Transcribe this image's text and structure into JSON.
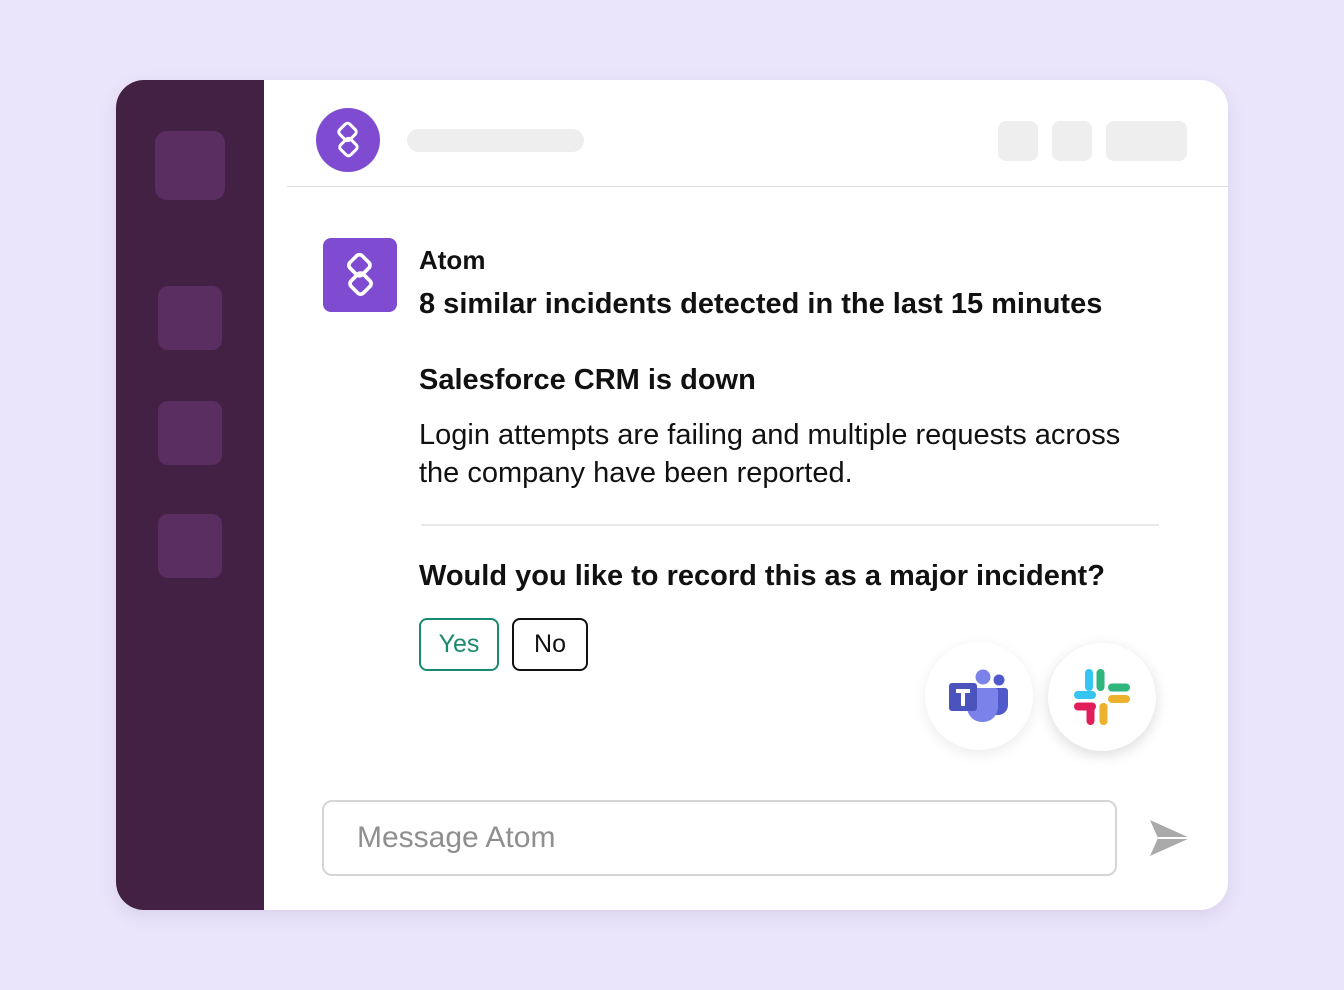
{
  "app": {
    "name": "Atom"
  },
  "message": {
    "sender": "Atom",
    "headline": "8 similar incidents detected in the last 15 minutes",
    "incident_title": "Salesforce CRM is down",
    "incident_description": "Login attempts are failing and multiple requests across the company have been reported.",
    "question": "Would you like to record this as a major incident?",
    "yes_label": "Yes",
    "no_label": "No"
  },
  "composer": {
    "placeholder": "Message Atom"
  },
  "integrations": [
    "microsoft-teams-icon",
    "slack-icon"
  ],
  "colors": {
    "background": "#ebe5fb",
    "sidebar": "#432145",
    "sidebar_tile": "#5b2e61",
    "brand": "#7e4bd1",
    "yes_accent": "#198a70"
  }
}
